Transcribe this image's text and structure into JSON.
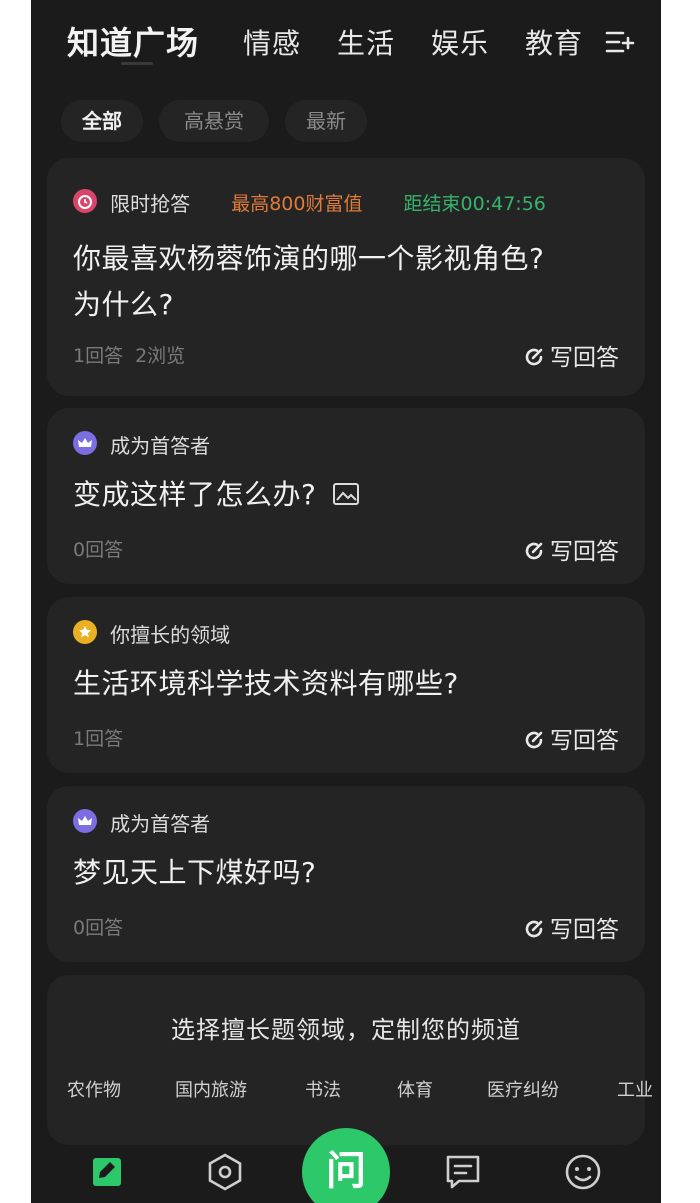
{
  "top_tabs": [
    "知道广场",
    "情感",
    "生活",
    "娱乐",
    "教育"
  ],
  "filters": [
    "全部",
    "高悬赏",
    "最新"
  ],
  "questions": [
    {
      "tag": "限时抢答",
      "reward": "最高800财富值",
      "countdown": "距结束00:47:56",
      "title_line1": "你最喜欢杨蓉饰演的哪一个影视角色?",
      "title_line2": "为什么?",
      "answers": "1回答",
      "views": "2浏览",
      "action": "写回答"
    },
    {
      "tag": "成为首答者",
      "title": "变成这样了怎么办?",
      "answers": "0回答",
      "action": "写回答"
    },
    {
      "tag": "你擅长的领域",
      "title": "生活环境科学技术资料有哪些?",
      "answers": "1回答",
      "action": "写回答"
    },
    {
      "tag": "成为首答者",
      "title": "梦见天上下煤好吗?",
      "answers": "0回答",
      "action": "写回答"
    }
  ],
  "domain_prompt": "选择擅长题领域，定制您的频道",
  "domains": [
    "农作物",
    "国内旅游",
    "书法",
    "体育",
    "医疗纠纷",
    "工业"
  ],
  "bottom_nav": {
    "ask_label": "问"
  },
  "colors": {
    "background": "#1b1b1b",
    "card": "#242424",
    "accent_green": "#2dc86a",
    "reward_orange": "#e07a3a",
    "countdown_green": "#35b56b"
  }
}
